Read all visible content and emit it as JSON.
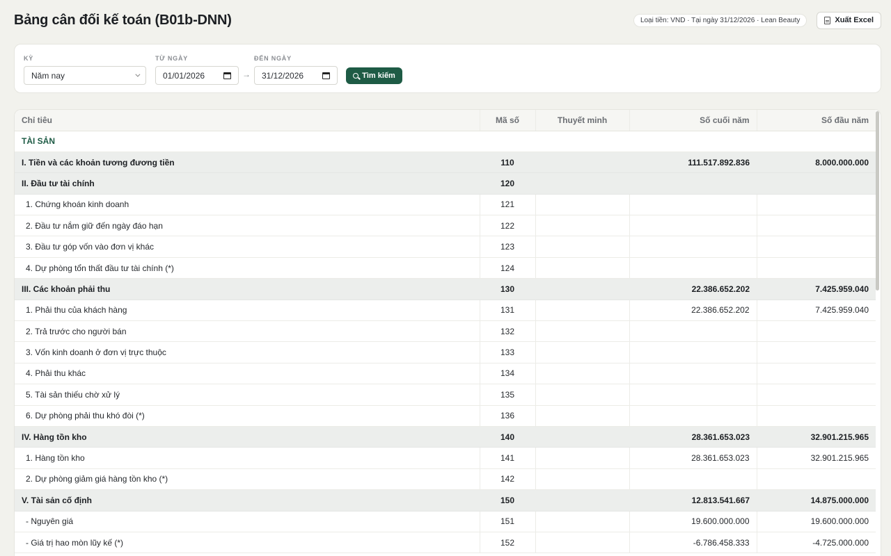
{
  "header": {
    "title": "Bảng cân đối kế toán (B01b-DNN)",
    "info": "Loại tiền: VND · Tại ngày 31/12/2026 · Lean Beauty",
    "export_label": "Xuất Excel"
  },
  "filters": {
    "period_label": "KỲ",
    "period_value": "Năm nay",
    "from_label": "TỪ NGÀY",
    "from_value": "01/01/2026",
    "to_label": "ĐẾN NGÀY",
    "to_value": "31/12/2026",
    "arrow": "→",
    "search_label": "Tìm kiếm"
  },
  "table": {
    "headers": [
      "Chỉ tiêu",
      "Mã số",
      "Thuyết minh",
      "Số cuối năm",
      "Số đầu năm"
    ],
    "rows": [
      {
        "type": "section",
        "label": "TÀI SẢN",
        "code": "",
        "note": "",
        "end": "",
        "start": ""
      },
      {
        "type": "group",
        "label": "I. Tiền và các khoản tương đương tiền",
        "code": "110",
        "note": "",
        "end": "111.517.892.836",
        "start": "8.000.000.000"
      },
      {
        "type": "group",
        "label": "II. Đầu tư tài chính",
        "code": "120",
        "note": "",
        "end": "",
        "start": ""
      },
      {
        "type": "item",
        "label": "1. Chứng khoán kinh doanh",
        "code": "121",
        "note": "",
        "end": "",
        "start": ""
      },
      {
        "type": "item",
        "label": "2. Đầu tư nắm giữ đến ngày đáo hạn",
        "code": "122",
        "note": "",
        "end": "",
        "start": ""
      },
      {
        "type": "item",
        "label": "3. Đầu tư góp vốn vào đơn vị khác",
        "code": "123",
        "note": "",
        "end": "",
        "start": ""
      },
      {
        "type": "item",
        "label": "4. Dự phòng tổn thất đầu tư tài chính (*)",
        "code": "124",
        "note": "",
        "end": "",
        "start": ""
      },
      {
        "type": "group",
        "label": "III. Các khoản phải thu",
        "code": "130",
        "note": "",
        "end": "22.386.652.202",
        "start": "7.425.959.040"
      },
      {
        "type": "item",
        "label": "1. Phải thu của khách hàng",
        "code": "131",
        "note": "",
        "end": "22.386.652.202",
        "start": "7.425.959.040"
      },
      {
        "type": "item",
        "label": "2. Trả trước cho người bán",
        "code": "132",
        "note": "",
        "end": "",
        "start": ""
      },
      {
        "type": "item",
        "label": "3. Vốn kinh doanh ở đơn vị trực thuộc",
        "code": "133",
        "note": "",
        "end": "",
        "start": ""
      },
      {
        "type": "item",
        "label": "4. Phải thu khác",
        "code": "134",
        "note": "",
        "end": "",
        "start": ""
      },
      {
        "type": "item",
        "label": "5. Tài sản thiếu chờ xử lý",
        "code": "135",
        "note": "",
        "end": "",
        "start": ""
      },
      {
        "type": "item",
        "label": "6. Dự phòng phải thu khó đòi (*)",
        "code": "136",
        "note": "",
        "end": "",
        "start": ""
      },
      {
        "type": "group",
        "label": "IV. Hàng tồn kho",
        "code": "140",
        "note": "",
        "end": "28.361.653.023",
        "start": "32.901.215.965"
      },
      {
        "type": "item",
        "label": "1. Hàng tồn kho",
        "code": "141",
        "note": "",
        "end": "28.361.653.023",
        "start": "32.901.215.965"
      },
      {
        "type": "item",
        "label": "2. Dự phòng giảm giá hàng tồn kho (*)",
        "code": "142",
        "note": "",
        "end": "",
        "start": ""
      },
      {
        "type": "group",
        "label": "V. Tài sản cố định",
        "code": "150",
        "note": "",
        "end": "12.813.541.667",
        "start": "14.875.000.000"
      },
      {
        "type": "item",
        "label": "- Nguyên giá",
        "code": "151",
        "note": "",
        "end": "19.600.000.000",
        "start": "19.600.000.000"
      },
      {
        "type": "item",
        "label": "- Giá trị hao mòn lũy kế (*)",
        "code": "152",
        "note": "",
        "end": "-6.786.458.333",
        "start": "-4.725.000.000"
      }
    ]
  }
}
